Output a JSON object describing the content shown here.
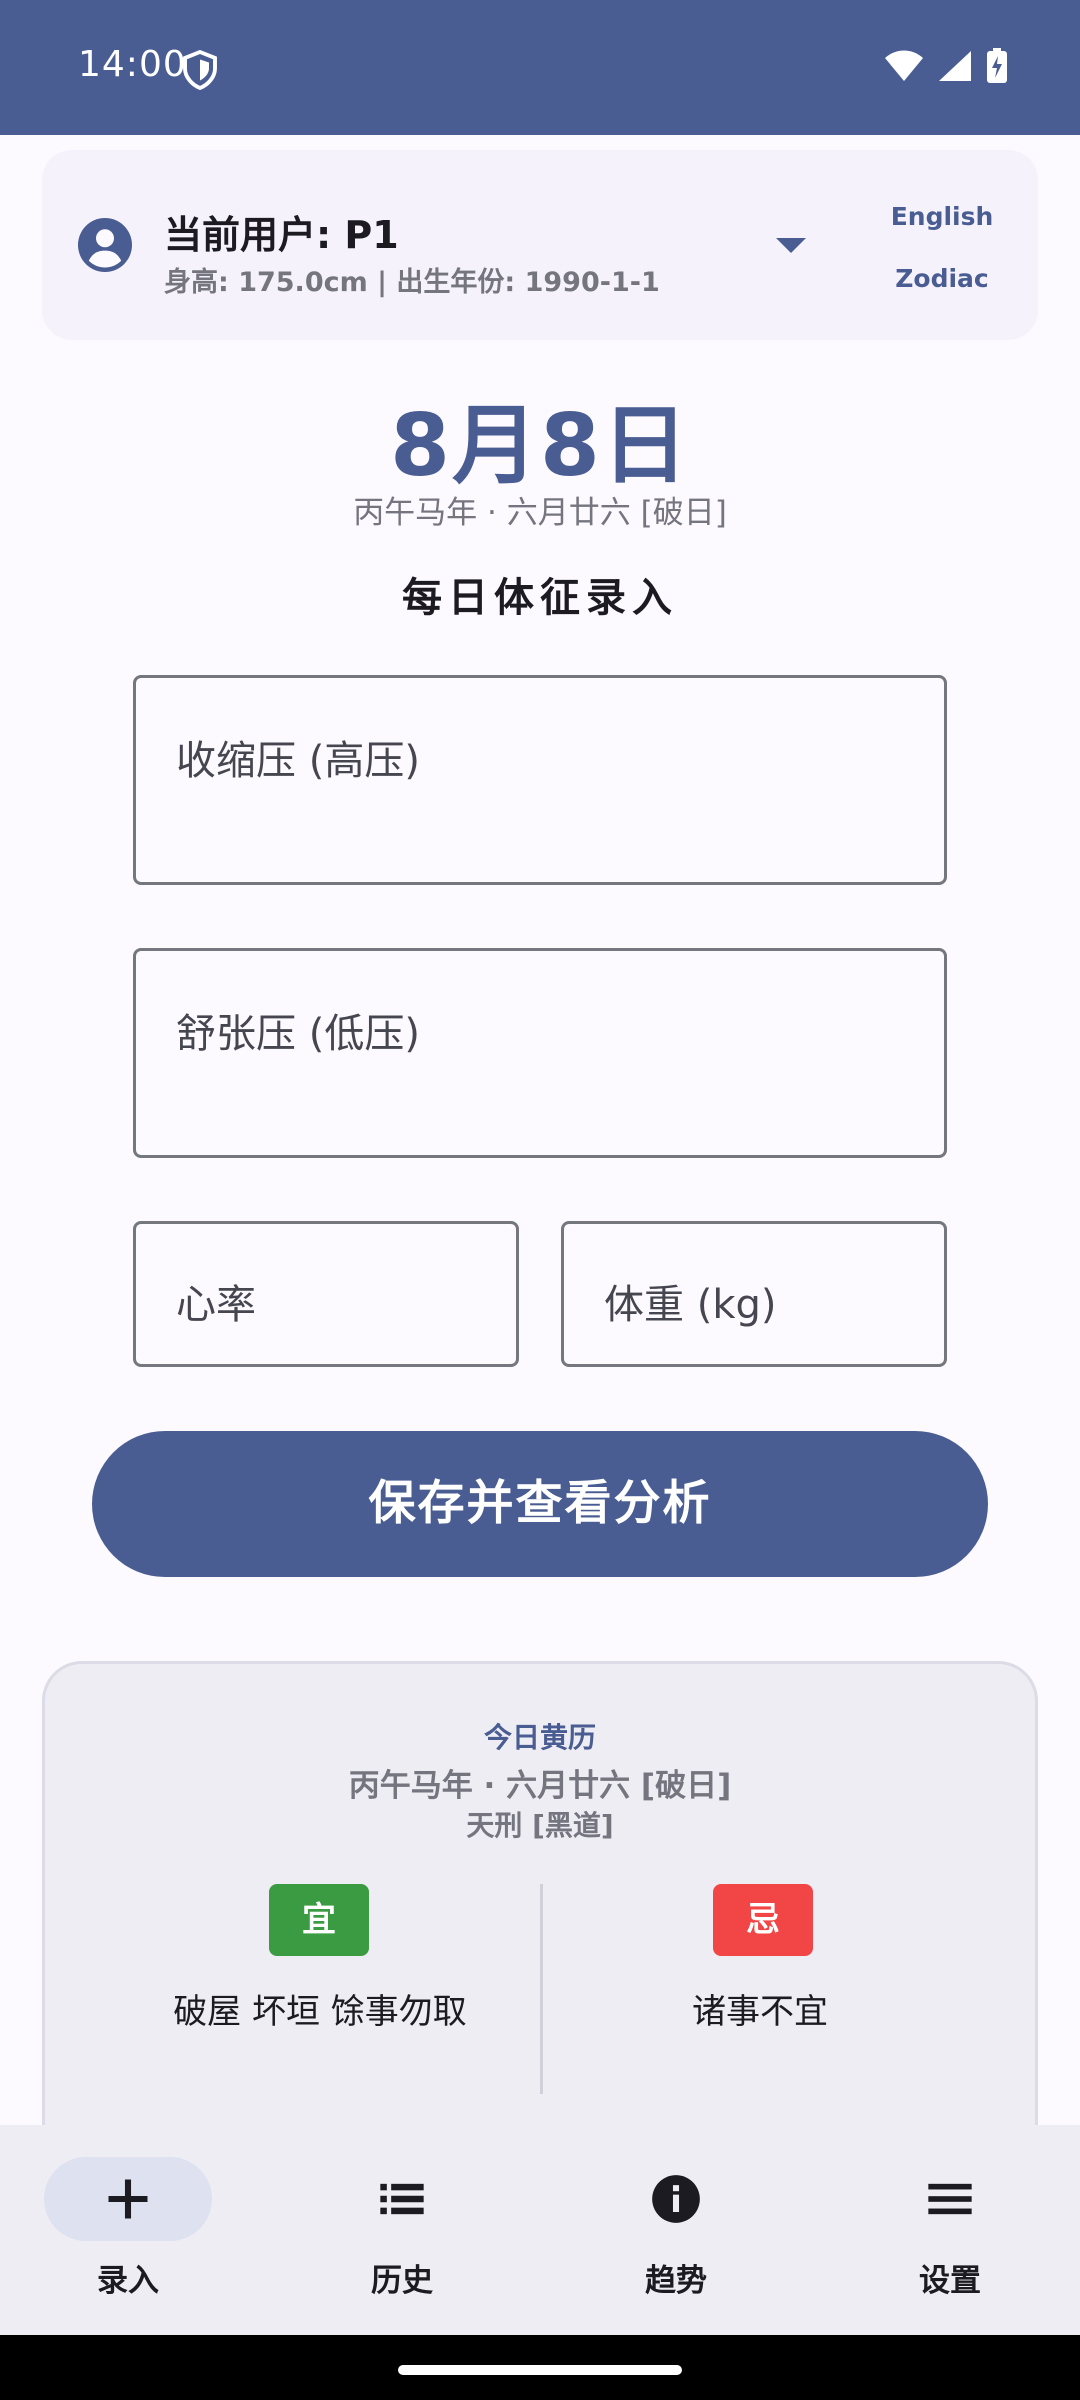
{
  "status_bar": {
    "time": "14:00",
    "icons": [
      "shield-icon",
      "wifi-icon",
      "signal-icon",
      "battery-charging-icon"
    ]
  },
  "user_card": {
    "name": "当前用户: P1",
    "meta": "身高: 175.0cm | 出生年份: 1990-1-1",
    "lang_english": "English",
    "lang_zodiac": "Zodiac"
  },
  "header": {
    "date": "8月8日",
    "lunar": "丙午马年 · 六月廿六 [破日]",
    "section_title": "每日体征录入"
  },
  "form": {
    "systolic_placeholder": "收缩压 (高压)",
    "diastolic_placeholder": "舒张压 (低压)",
    "heart_rate_placeholder": "心率",
    "weight_placeholder": "体重 (kg)",
    "save_label": "保存并查看分析"
  },
  "almanac": {
    "title": "今日黄历",
    "lunar": "丙午马年 · 六月廿六 [破日]",
    "god": "天刑 [黑道]",
    "yi_badge": "宜",
    "yi_text": "破屋 坏垣 馀事勿取",
    "ji_badge": "忌",
    "ji_text": "诸事不宜"
  },
  "bottom_nav": {
    "items": [
      {
        "label": "录入",
        "icon": "plus-icon",
        "selected": true
      },
      {
        "label": "历史",
        "icon": "list-icon",
        "selected": false
      },
      {
        "label": "趋势",
        "icon": "info-icon",
        "selected": false
      },
      {
        "label": "设置",
        "icon": "menu-icon",
        "selected": false
      }
    ]
  },
  "colors": {
    "primary": "#495d92",
    "background": "#fcf9ff",
    "yi": "#3a9b42",
    "ji": "#f24646"
  }
}
